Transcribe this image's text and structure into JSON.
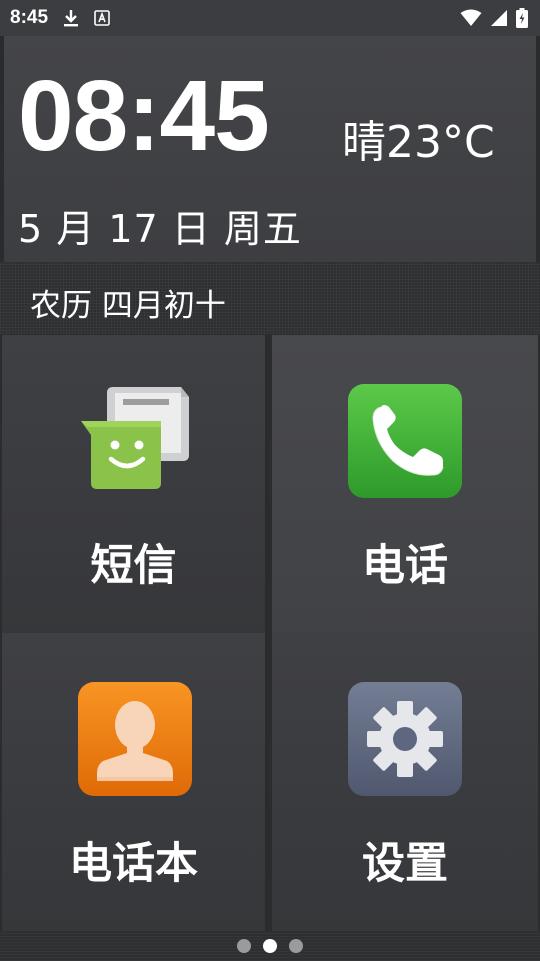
{
  "status_bar": {
    "time": "8:45",
    "icons": [
      "download-icon",
      "keyboard-a-icon",
      "wifi-icon",
      "signal-icon",
      "battery-charging-icon"
    ]
  },
  "clock": {
    "time": "08:45",
    "weather": "晴23°C",
    "date": "5 月 17 日  周五"
  },
  "lunar": {
    "text": "农历 四月初十"
  },
  "tiles": [
    {
      "label": "短信",
      "icon": "sms-icon",
      "color": "#8bc34a"
    },
    {
      "label": "电话",
      "icon": "phone-icon",
      "color": "#3dad3a"
    },
    {
      "label": "电话本",
      "icon": "contacts-icon",
      "color": "#f07c0a"
    },
    {
      "label": "设置",
      "icon": "settings-gear-icon",
      "color": "#5d6780"
    }
  ],
  "pager": {
    "total": 3,
    "active_index": 1
  }
}
